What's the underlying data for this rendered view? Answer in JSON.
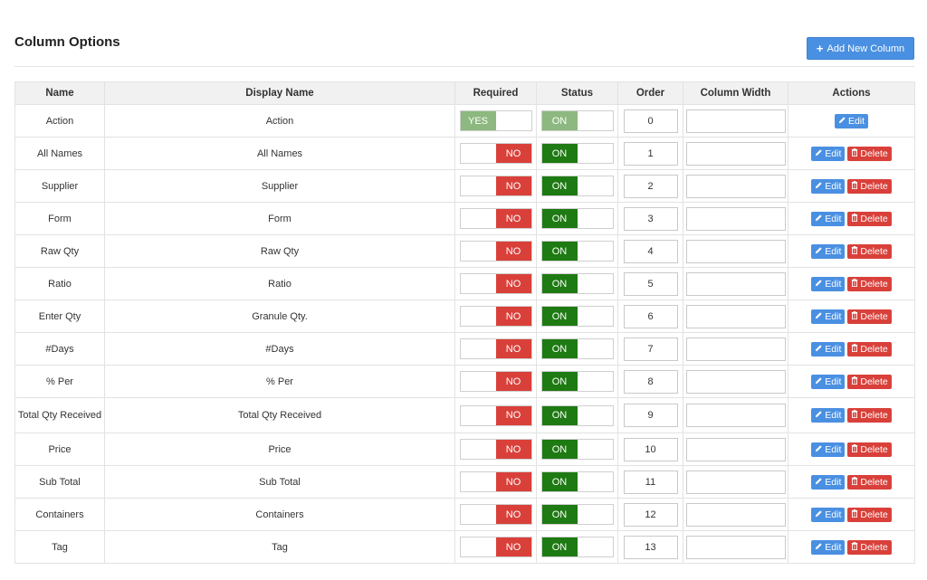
{
  "header": {
    "title": "Column Options",
    "add_button_label": "Add New Column"
  },
  "table": {
    "columns": [
      "Name",
      "Display Name",
      "Required",
      "Status",
      "Order",
      "Column Width",
      "Actions"
    ],
    "rows": [
      {
        "name": "Action",
        "display_name": "Action",
        "required": "YES",
        "status": "ON",
        "order": "0",
        "width": "",
        "deletable": false
      },
      {
        "name": "All Names",
        "display_name": "All Names",
        "required": "NO",
        "status": "ON",
        "order": "1",
        "width": "",
        "deletable": true
      },
      {
        "name": "Supplier",
        "display_name": "Supplier",
        "required": "NO",
        "status": "ON",
        "order": "2",
        "width": "",
        "deletable": true
      },
      {
        "name": "Form",
        "display_name": "Form",
        "required": "NO",
        "status": "ON",
        "order": "3",
        "width": "",
        "deletable": true
      },
      {
        "name": "Raw Qty",
        "display_name": "Raw Qty",
        "required": "NO",
        "status": "ON",
        "order": "4",
        "width": "",
        "deletable": true
      },
      {
        "name": "Ratio",
        "display_name": "Ratio",
        "required": "NO",
        "status": "ON",
        "order": "5",
        "width": "",
        "deletable": true
      },
      {
        "name": "Enter Qty",
        "display_name": "Granule Qty.",
        "required": "NO",
        "status": "ON",
        "order": "6",
        "width": "",
        "deletable": true
      },
      {
        "name": "#Days",
        "display_name": "#Days",
        "required": "NO",
        "status": "ON",
        "order": "7",
        "width": "",
        "deletable": true
      },
      {
        "name": "% Per",
        "display_name": "% Per",
        "required": "NO",
        "status": "ON",
        "order": "8",
        "width": "",
        "deletable": true
      },
      {
        "name": "Total Qty Received",
        "display_name": "Total Qty Received",
        "required": "NO",
        "status": "ON",
        "order": "9",
        "width": "",
        "deletable": true
      },
      {
        "name": "Price",
        "display_name": "Price",
        "required": "NO",
        "status": "ON",
        "order": "10",
        "width": "",
        "deletable": true
      },
      {
        "name": "Sub Total",
        "display_name": "Sub Total",
        "required": "NO",
        "status": "ON",
        "order": "11",
        "width": "",
        "deletable": true
      },
      {
        "name": "Containers",
        "display_name": "Containers",
        "required": "NO",
        "status": "ON",
        "order": "12",
        "width": "",
        "deletable": true
      },
      {
        "name": "Tag",
        "display_name": "Tag",
        "required": "NO",
        "status": "ON",
        "order": "13",
        "width": "",
        "deletable": true
      }
    ],
    "edit_label": "Edit",
    "delete_label": "Delete"
  },
  "colors": {
    "primary": "#4a90e2",
    "on_green": "#1e7a12",
    "no_red": "#d9403a",
    "disabled_green": "#8db87f"
  }
}
